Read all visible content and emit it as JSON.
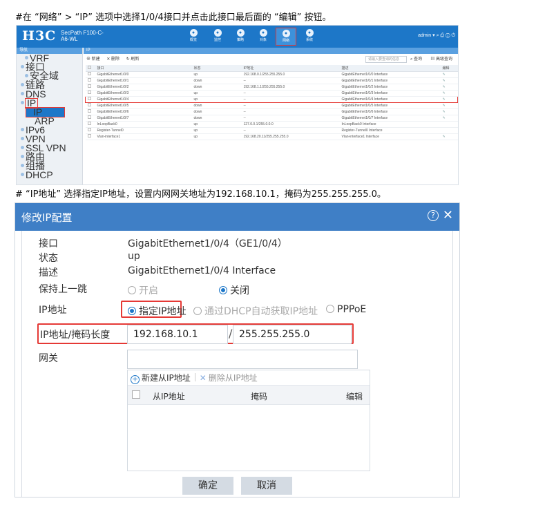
{
  "captions": {
    "step1": "#在 “网络” > “IP” 选项中选择1/0/4接口并点击此接口最后面的 “编辑” 按钮。",
    "step2": "# “IP地址” 选择指定IP地址，设置内网网关地址为192.168.10.1，掩码为255.255.255.0。"
  },
  "shot1": {
    "logo": "H3C",
    "model_line1": "SecPath F100-C-",
    "model_line2": "A6-WL",
    "nav": [
      "概览",
      "监控",
      "策略",
      "对象",
      "网络",
      "系统"
    ],
    "nav_icons": [
      "dashboard-icon",
      "monitor-icon",
      "shield-icon",
      "share-icon",
      "globe-icon",
      "system-icon"
    ],
    "active_nav": "网络",
    "top_right": "admin ▾  ⌕ ⎙ ⓘ ⏻",
    "left_header": "导航",
    "left_items": [
      {
        "label": "VRF",
        "level": "sub"
      },
      {
        "label": "接口",
        "level": "top"
      },
      {
        "label": "安全域",
        "level": "sub"
      },
      {
        "label": "链路",
        "level": "top"
      },
      {
        "label": "DNS",
        "level": "top"
      },
      {
        "label": "IP",
        "level": "top",
        "boxed": true
      },
      {
        "label": "IP",
        "level": "selected"
      },
      {
        "label": "ARP",
        "level": "sub2"
      },
      {
        "label": "IPv6",
        "level": "top"
      },
      {
        "label": "VPN",
        "level": "top"
      },
      {
        "label": "SSL VPN",
        "level": "top"
      },
      {
        "label": "路由",
        "level": "top"
      },
      {
        "label": "组播",
        "level": "top"
      },
      {
        "label": "DHCP",
        "level": "top"
      }
    ],
    "breadcrumb": "IP",
    "toolbar": {
      "new": "⊕ 新建",
      "delete": "✕ 删除",
      "refresh": "↻ 刷新",
      "search_placeholder": "请输入要查询的信息",
      "query": "⌕ 查询",
      "advanced": "▤ 高级查询"
    },
    "columns": [
      "接口",
      "状态",
      "IP地址",
      "描述",
      "编辑"
    ],
    "rows": [
      {
        "iface": "GigabitEthernet1/0/0",
        "status": "up",
        "ip": "192.168.0.1/255.255.255.0",
        "desc": "GigabitEthernet1/0/0 Interface",
        "edit": "✎"
      },
      {
        "iface": "GigabitEthernet1/0/1",
        "status": "down",
        "ip": "--",
        "desc": "GigabitEthernet1/0/1 Interface",
        "edit": "✎"
      },
      {
        "iface": "GigabitEthernet1/0/2",
        "status": "down",
        "ip": "192.168.1.1/255.255.255.0",
        "desc": "GigabitEthernet1/0/2 Interface",
        "edit": "✎"
      },
      {
        "iface": "GigabitEthernet1/0/3",
        "status": "up",
        "ip": "--",
        "desc": "GigabitEthernet1/0/3 Interface",
        "edit": "✎"
      },
      {
        "iface": "GigabitEthernet1/0/4",
        "status": "up",
        "ip": "--",
        "desc": "GigabitEthernet1/0/4 Interface",
        "edit": "✎",
        "highlight": true
      },
      {
        "iface": "GigabitEthernet1/0/5",
        "status": "down",
        "ip": "--",
        "desc": "GigabitEthernet1/0/5 Interface",
        "edit": "✎"
      },
      {
        "iface": "GigabitEthernet1/0/6",
        "status": "down",
        "ip": "--",
        "desc": "GigabitEthernet1/0/6 Interface",
        "edit": "✎"
      },
      {
        "iface": "GigabitEthernet1/0/7",
        "status": "down",
        "ip": "--",
        "desc": "GigabitEthernet1/0/7 Interface",
        "edit": "✎"
      },
      {
        "iface": "InLoopBack0",
        "status": "up",
        "ip": "127.0.0.1/255.0.0.0",
        "desc": "InLoopBack0 Interface",
        "edit": ""
      },
      {
        "iface": "Register-Tunnel0",
        "status": "up",
        "ip": "--",
        "desc": "Register-Tunnel0 Interface",
        "edit": ""
      },
      {
        "iface": "Vlan-interface1",
        "status": "up",
        "ip": "192.168.20.11/255.255.255.0",
        "desc": "Vlan-interface1 Interface",
        "edit": "✎"
      }
    ]
  },
  "dialog": {
    "title": "修改IP配置",
    "help": "?",
    "close": "✕",
    "labels": {
      "interface": "接口",
      "status": "状态",
      "desc": "描述",
      "keepalive": "保持上一跳",
      "ip": "IP地址",
      "ipmask": "IP地址/掩码长度",
      "gateway": "网关"
    },
    "values": {
      "interface": "GigabitEthernet1/0/4（GE1/0/4）",
      "status": "up",
      "desc": "GigabitEthernet1/0/4 Interface"
    },
    "keepalive_options": [
      {
        "label": "开启",
        "checked": false
      },
      {
        "label": "关闭",
        "checked": true
      }
    ],
    "ip_options": [
      {
        "label": "指定IP地址",
        "checked": true
      },
      {
        "label": "通过DHCP自动获取IP地址",
        "checked": false
      },
      {
        "label": "PPPoE",
        "checked": false
      }
    ],
    "ip_address": "192.168.10.1",
    "slash": "/",
    "mask": "255.255.255.0",
    "gateway_value": "",
    "secondary": {
      "add": "新建从IP地址",
      "remove": "删除从IP地址",
      "columns": [
        "从IP地址",
        "掩码",
        "编辑"
      ]
    },
    "ok": "确定",
    "cancel": "取消"
  },
  "colors": {
    "brand_blue": "#1d77c8",
    "title_blue": "#3f7fc6",
    "highlight_red": "#e53935"
  }
}
